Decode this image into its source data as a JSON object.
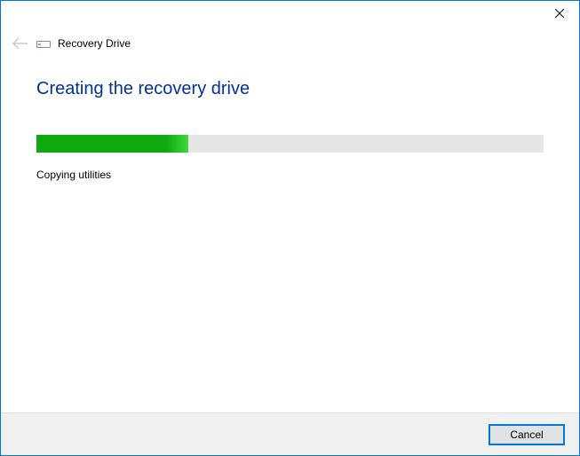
{
  "window": {
    "title": "Recovery Drive"
  },
  "content": {
    "heading": "Creating the recovery drive",
    "status_text": "Copying utilities",
    "progress_percent": 30
  },
  "footer": {
    "cancel_label": "Cancel"
  }
}
